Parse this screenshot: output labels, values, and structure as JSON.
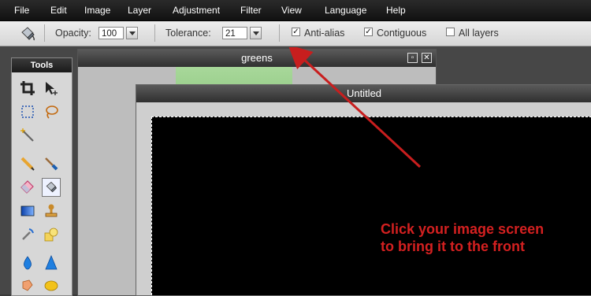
{
  "menu": [
    "File",
    "Edit",
    "Image",
    "Layer",
    "Adjustment",
    "Filter",
    "View",
    "Language",
    "Help"
  ],
  "toolbar": {
    "opacity_label": "Opacity:",
    "opacity_value": "100",
    "tolerance_label": "Tolerance:",
    "tolerance_value": "21",
    "antialias_label": "Anti-alias",
    "antialias_checked": "✓",
    "contiguous_label": "Contiguous",
    "contiguous_checked": "✓",
    "all_layers_label": "All layers"
  },
  "tools_panel": {
    "title": "Tools"
  },
  "windows": {
    "greens_title": "greens",
    "untitled_title": "Untitled"
  },
  "annotation": {
    "line1": "Click your image screen",
    "line2": "to bring it to the front",
    "color": "#d42020"
  }
}
